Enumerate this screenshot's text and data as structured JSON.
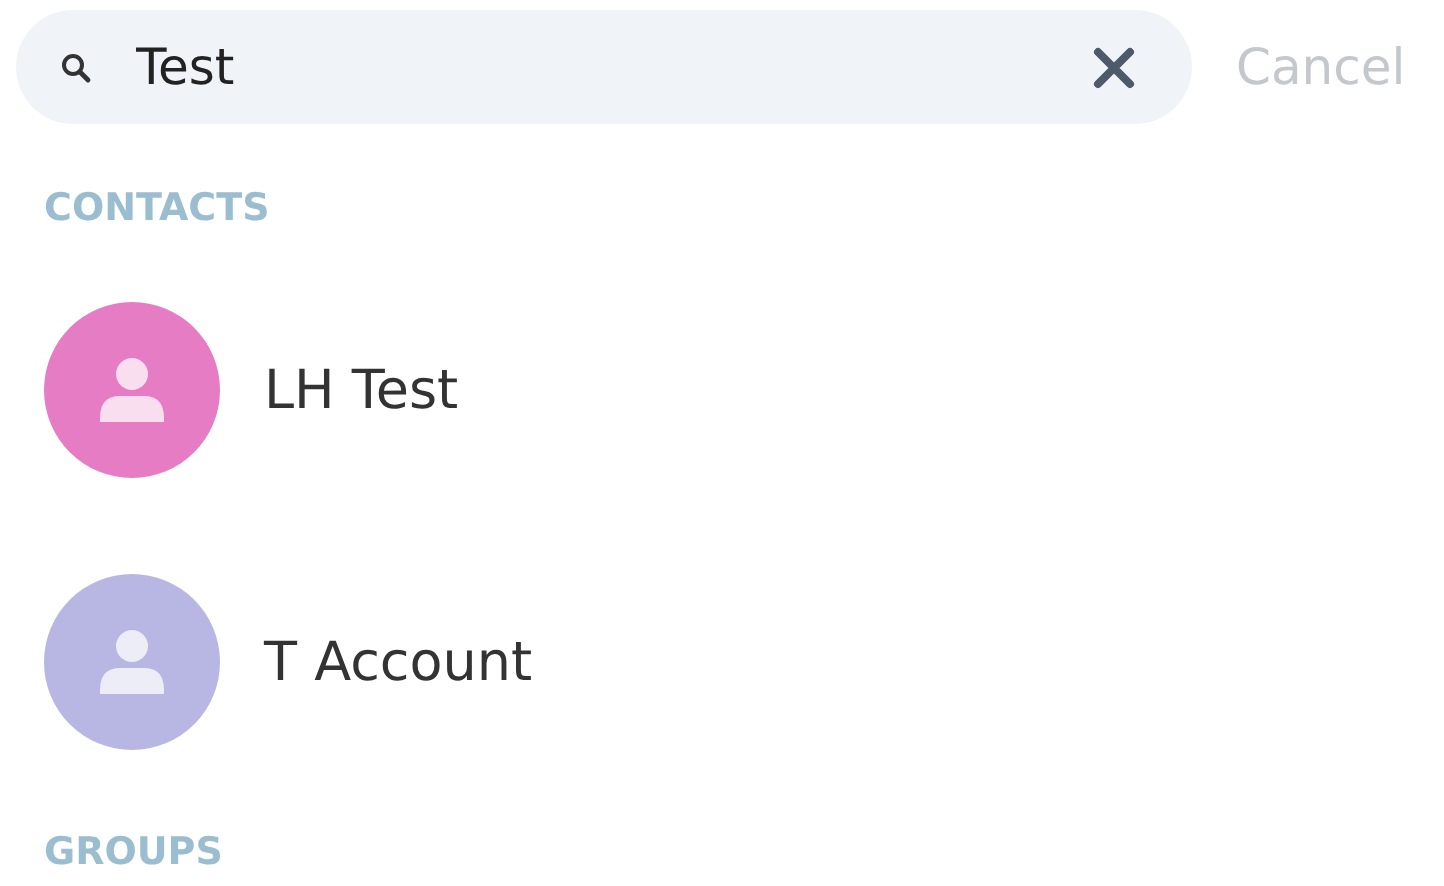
{
  "search": {
    "value": "Test"
  },
  "cancel": "Cancel",
  "sections": [
    {
      "title": "CONTACTS",
      "contacts": [
        {
          "name": "LH Test",
          "color": "#e67cc4"
        },
        {
          "name": "T Account",
          "color": "#b8b6e2"
        }
      ]
    },
    {
      "title": "GROUPS"
    }
  ]
}
